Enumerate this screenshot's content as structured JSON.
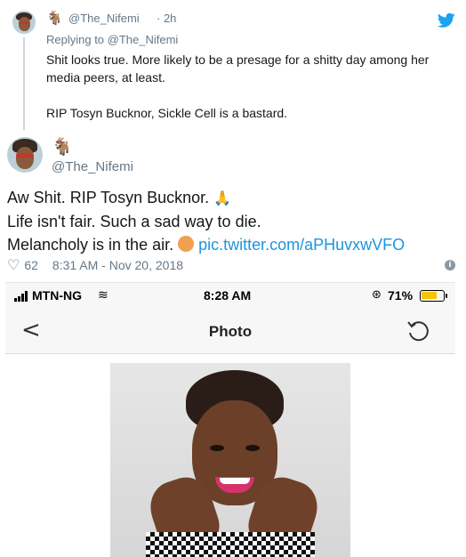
{
  "reply_tweet": {
    "emoji": "🐐",
    "handle": "@The_Nifemi",
    "time": "· 2h",
    "replying_to": "Replying to @The_Nifemi",
    "text_line_1": "Shit looks true. More likely to be a presage for a shitty day among her media peers, at least.",
    "text_line_2": "RIP Tosyn Bucknor, Sickle Cell is a bastard."
  },
  "main_tweet": {
    "emoji": "🐐",
    "handle": "@The_Nifemi",
    "line_1": "Aw Shit. RIP Tosyn Bucknor.",
    "line_1_emoji": "🙏",
    "line_2": "Life isn't fair. Such a sad way to die.",
    "line_3": "Melancholy is in the air.",
    "line_3_emoji": "🤦",
    "link": "pic.twitter.com/aPHuvxwVFO",
    "like_count": "62",
    "timestamp": "8:31 AM - Nov 20, 2018"
  },
  "embedded_screenshot": {
    "carrier": "MTN-NG",
    "clock": "8:28 AM",
    "battery_percent_label": "71%",
    "battery_level": 0.71,
    "nav_title": "Photo",
    "back_icon": "<"
  },
  "icons": {
    "twitter": "twitter-bird-icon",
    "like": "heart-icon",
    "info": "info-icon",
    "signal": "signal-bars-icon",
    "wifi": "wifi-icon",
    "rotation_lock": "rotation-lock-icon",
    "battery": "battery-icon",
    "refresh": "refresh-icon"
  },
  "colors": {
    "twitter_blue": "#1da1f2",
    "link": "#1b95e0",
    "muted": "#657786",
    "battery": "#f5c400"
  }
}
